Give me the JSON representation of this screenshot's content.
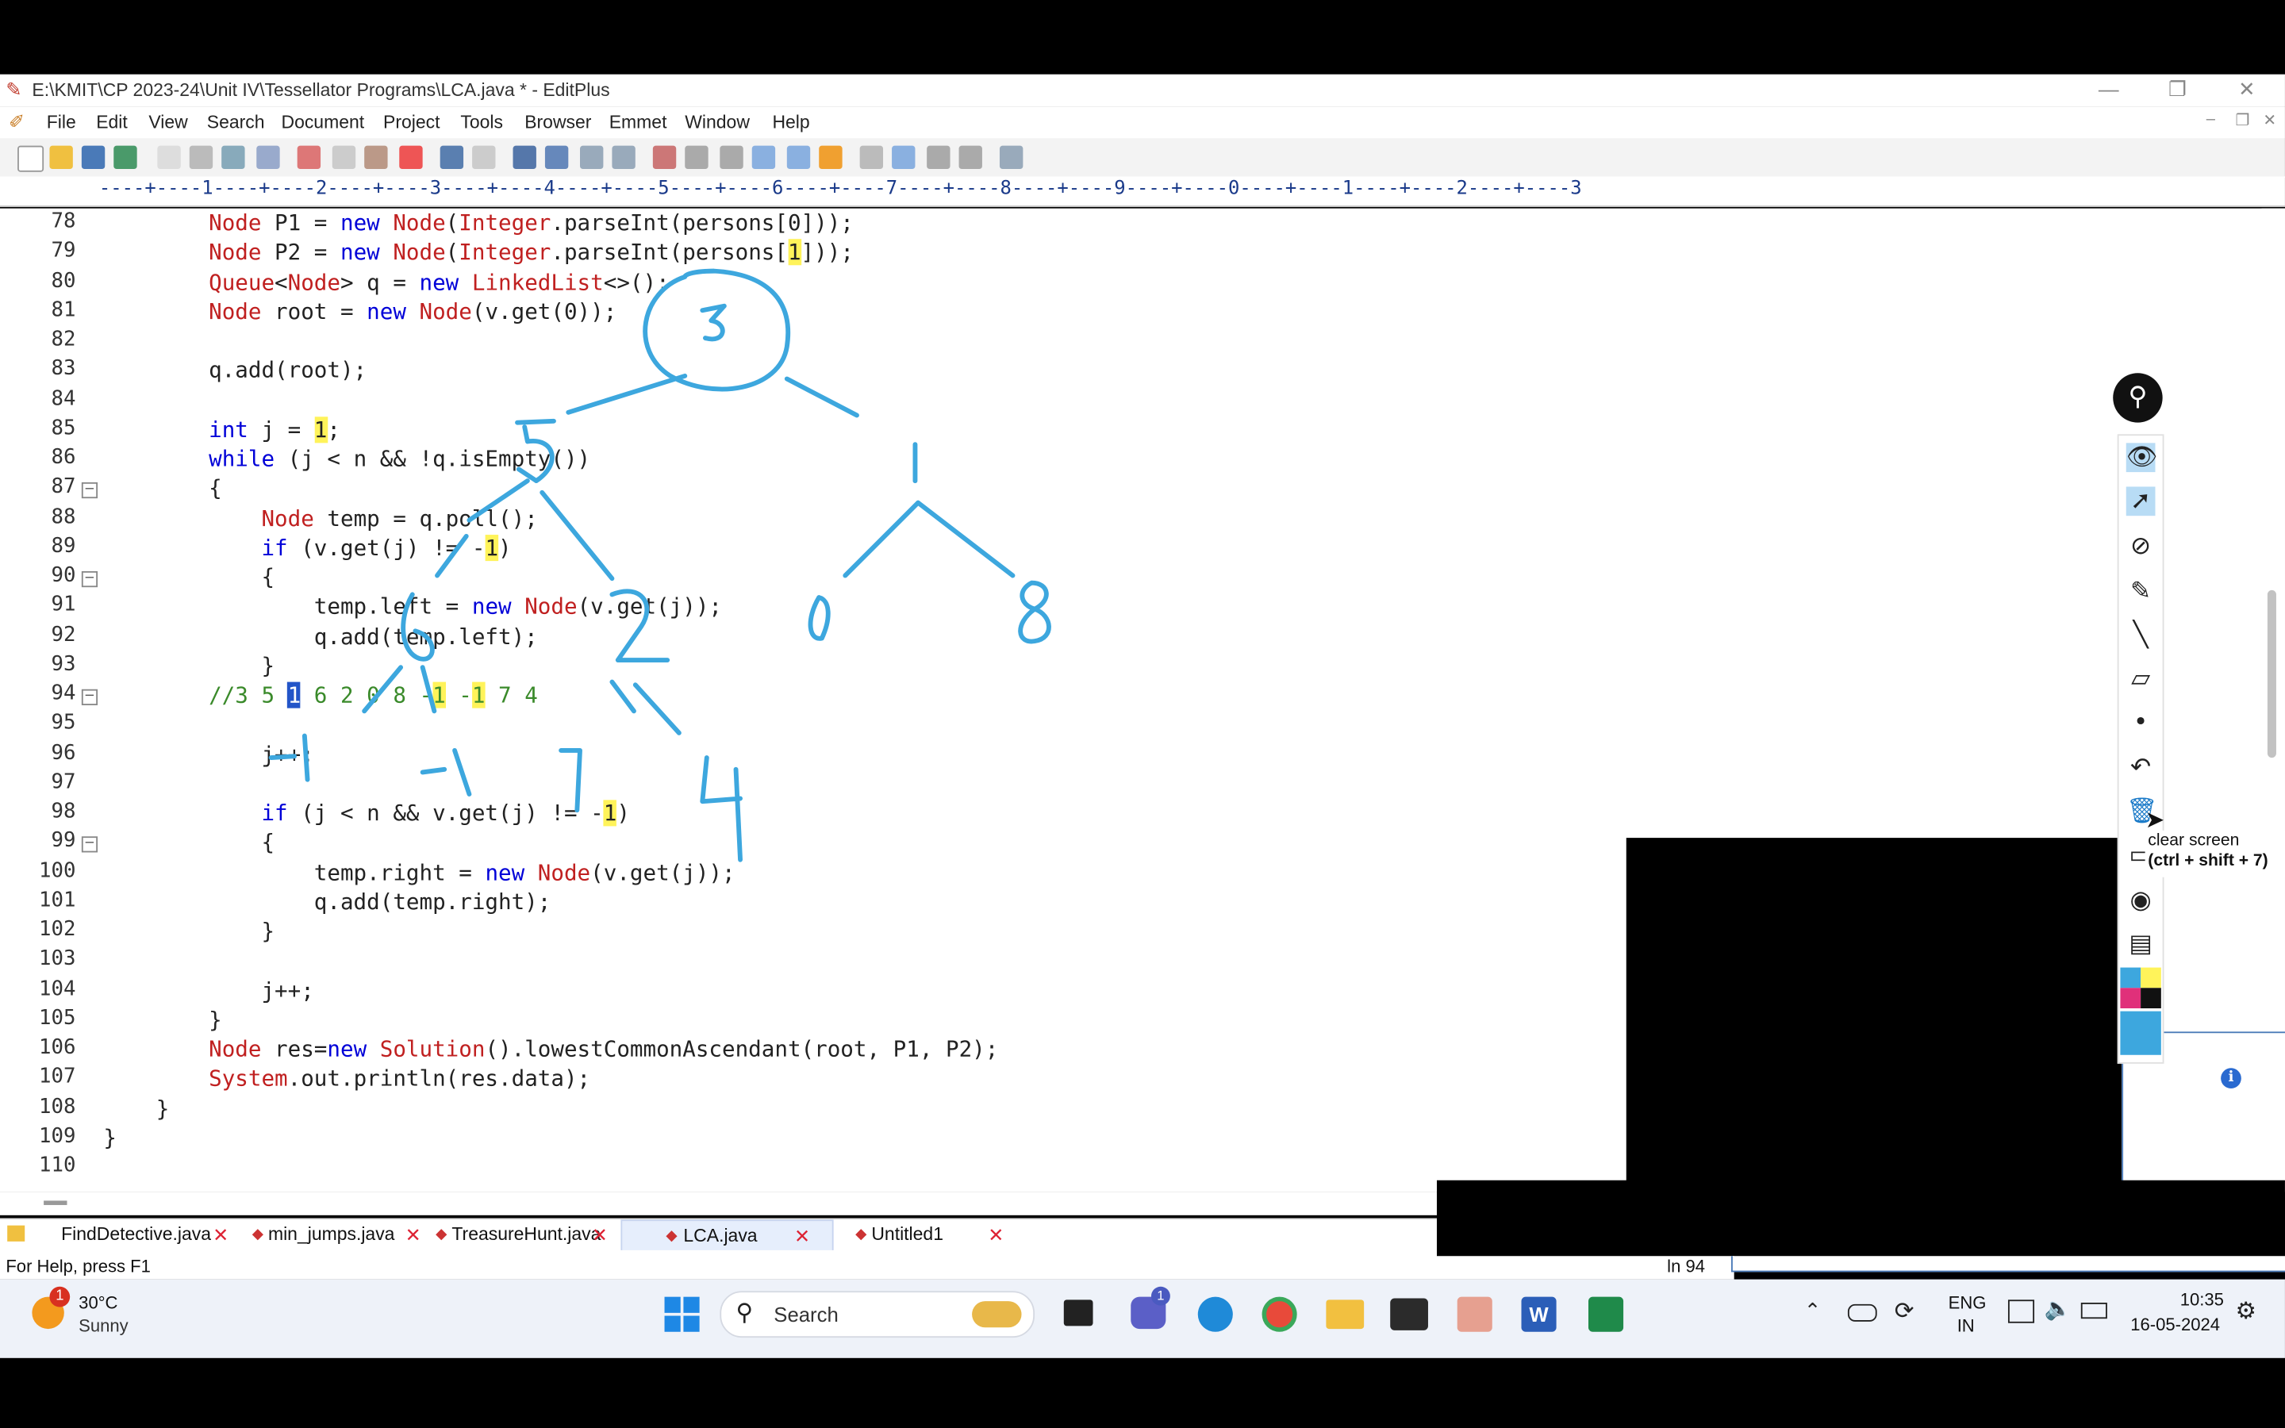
{
  "window": {
    "title": "E:\\KMIT\\CP 2023-24\\Unit IV\\Tessellator Programs\\LCA.java * - EditPlus",
    "controls": [
      "—",
      "❐",
      "✕"
    ]
  },
  "menu": [
    "File",
    "Edit",
    "View",
    "Search",
    "Document",
    "Project",
    "Tools",
    "Browser",
    "Emmet",
    "Window",
    "Help"
  ],
  "ruler": "----+----1----+----2----+----3----+----4----+----5----+----6----+----7----+----8----+----9----+----0----+----1----+----2----+----3",
  "code_lines": [
    {
      "n": "78",
      "t": "        Node P1 = new Node(Integer.parseInt(persons[0]));"
    },
    {
      "n": "79",
      "t": "        Node P2 = new Node(Integer.parseInt(persons[1]));"
    },
    {
      "n": "80",
      "t": "        Queue<Node> q = new LinkedList<>();"
    },
    {
      "n": "81",
      "t": "        Node root = new Node(v.get(0));"
    },
    {
      "n": "82",
      "t": ""
    },
    {
      "n": "83",
      "t": "        q.add(root);"
    },
    {
      "n": "84",
      "t": ""
    },
    {
      "n": "85",
      "t": "        int j = 1;"
    },
    {
      "n": "86",
      "t": "        while (j < n && !q.isEmpty())"
    },
    {
      "n": "87",
      "t": "        {"
    },
    {
      "n": "88",
      "t": "            Node temp = q.poll();"
    },
    {
      "n": "89",
      "t": "            if (v.get(j) != -1)"
    },
    {
      "n": "90",
      "t": "            {"
    },
    {
      "n": "91",
      "t": "                temp.left = new Node(v.get(j));"
    },
    {
      "n": "92",
      "t": "                q.add(temp.left);"
    },
    {
      "n": "93",
      "t": "            }"
    },
    {
      "n": "94",
      "t": "        //3 5 1 6 2 0 8 -1 -1 7 4"
    },
    {
      "n": "95",
      "t": ""
    },
    {
      "n": "96",
      "t": "            j++;"
    },
    {
      "n": "97",
      "t": ""
    },
    {
      "n": "98",
      "t": "            if (j < n && v.get(j) != -1)"
    },
    {
      "n": "99",
      "t": "            {"
    },
    {
      "n": "100",
      "t": "                temp.right = new Node(v.get(j));"
    },
    {
      "n": "101",
      "t": "                q.add(temp.right);"
    },
    {
      "n": "102",
      "t": "            }"
    },
    {
      "n": "103",
      "t": ""
    },
    {
      "n": "104",
      "t": "            j++;"
    },
    {
      "n": "105",
      "t": "        }"
    },
    {
      "n": "106",
      "t": "        Node res=new Solution().lowestCommonAscendant(root, P1, P2);"
    },
    {
      "n": "107",
      "t": "        System.out.println(res.data);"
    },
    {
      "n": "108",
      "t": "    }"
    },
    {
      "n": "109",
      "t": "}"
    },
    {
      "n": "110",
      "t": ""
    }
  ],
  "tabs": [
    "FindDetective.java",
    "min_jumps.java",
    "TreasureHunt.java",
    "LCA.java",
    "Untitled1"
  ],
  "status": {
    "help": "For Help, press F1",
    "line": "ln 94"
  },
  "tooltip": {
    "label": "clear screen",
    "shortcut": "(ctrl + shift + 7)"
  },
  "taskbar": {
    "weather_temp": "30°C",
    "weather_desc": "Sunny",
    "weather_badge": "1",
    "search_placeholder": "Search",
    "teams_badge": "1",
    "lang1": "ENG",
    "lang2": "IN",
    "time": "10:35",
    "date": "16-05-2024"
  },
  "colors": {
    "annotation_ink": "#3da7de",
    "keyword": "#0000d8",
    "type": "#c02020",
    "comment": "#3a8a2a",
    "highlight": "#fff35a"
  }
}
